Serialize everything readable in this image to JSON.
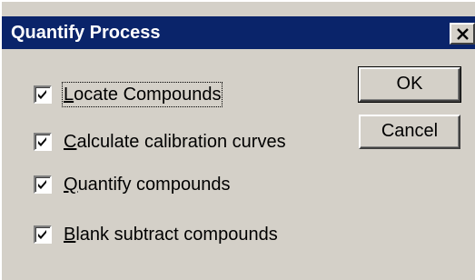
{
  "dialog": {
    "title": "Quantify Process",
    "close_icon": "close-icon"
  },
  "options": [
    {
      "label": "Locate Compounds",
      "mnemonic": "L",
      "rest": "ocate Compounds",
      "checked": true,
      "focused": true
    },
    {
      "label": "Calculate calibration curves",
      "mnemonic": "C",
      "rest": "alculate calibration curves",
      "checked": true,
      "focused": false
    },
    {
      "label": "Quantify compounds",
      "mnemonic": "Q",
      "rest": "uantify compounds",
      "checked": true,
      "focused": false
    },
    {
      "label": "Blank subtract compounds",
      "mnemonic": "B",
      "rest": "lank subtract compounds",
      "checked": true,
      "focused": false
    }
  ],
  "buttons": {
    "ok_label": "OK",
    "cancel_label": "Cancel"
  },
  "colors": {
    "titlebar": "#0a246a",
    "face": "#d4d0c8"
  }
}
